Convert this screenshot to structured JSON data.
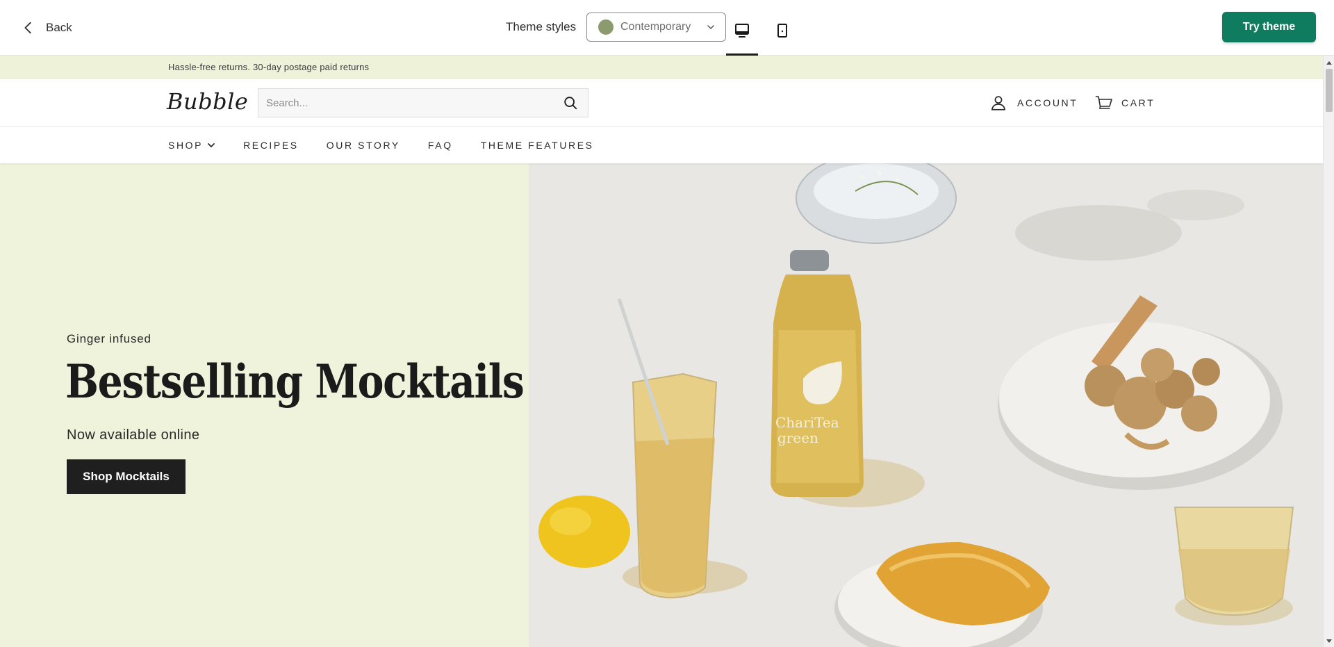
{
  "toolbar": {
    "back_label": "Back",
    "theme_styles_label": "Theme styles",
    "theme_style_value": "Contemporary",
    "theme_style_swatch": "#8c9a6e",
    "try_theme_label": "Try theme",
    "accent_color": "#0f7b5f",
    "active_device": "desktop"
  },
  "store": {
    "announcement": "Hassle-free returns. 30-day postage paid returns",
    "logo": "Bubble",
    "search_placeholder": "Search...",
    "account_label": "ACCOUNT",
    "cart_label": "CART",
    "nav": [
      "SHOP",
      "RECIPES",
      "OUR STORY",
      "FAQ",
      "THEME FEATURES"
    ],
    "hero": {
      "eyebrow": "Ginger infused",
      "headline": "Bestselling Mocktails",
      "subhead": "Now available online",
      "cta_label": "Shop Mocktails",
      "bottle_label_line1": "ChariTea",
      "bottle_label_line2": "green",
      "left_bg": "#f0f3dc"
    }
  },
  "icons": [
    "chevron-left-icon",
    "chevron-down-icon",
    "desktop-icon",
    "mobile-icon",
    "search-icon",
    "user-icon",
    "cart-icon"
  ]
}
